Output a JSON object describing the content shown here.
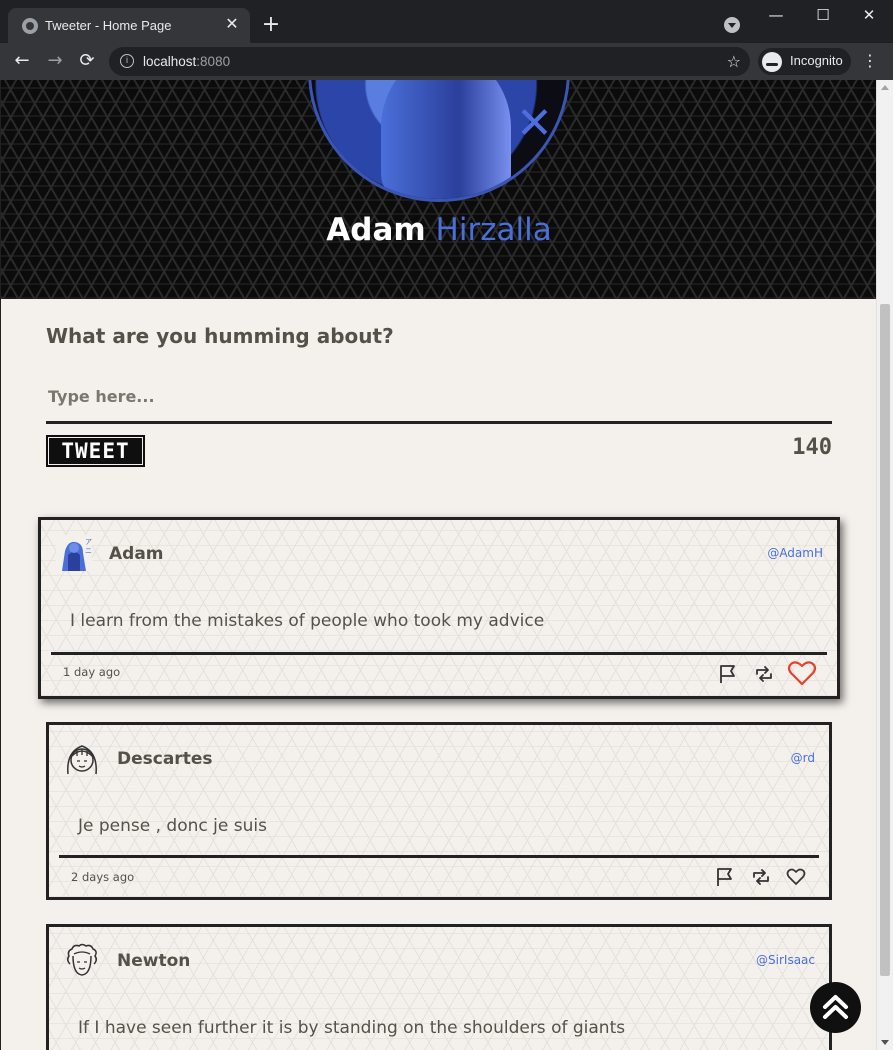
{
  "browser": {
    "tab_title": "Tweeter - Home Page",
    "url_host": "localhost",
    "url_port": ":8080",
    "incognito_label": "Incognito"
  },
  "hero": {
    "first_name": "Adam",
    "last_name": "Hirzalla"
  },
  "compose": {
    "question": "What are you humming about?",
    "placeholder": "Type here...",
    "button_label": "TWEET",
    "counter": "140"
  },
  "tweets": [
    {
      "name": "Adam",
      "handle": "@AdamH",
      "text": "I learn from the mistakes of people who took my advice",
      "date": "1 day ago",
      "liked": true,
      "avatar_icon": "anime-avatar-icon"
    },
    {
      "name": "Descartes",
      "handle": "@rd",
      "text": "Je pense , donc je suis",
      "date": "2 days ago",
      "liked": false,
      "avatar_icon": "girl-avatar-icon"
    },
    {
      "name": "Newton",
      "handle": "@SirIsaac",
      "text": "If I have seen further it is by standing on the shoulders of giants",
      "date": "",
      "liked": false,
      "avatar_icon": "curly-hair-avatar-icon"
    }
  ],
  "colors": {
    "accent_blue": "#4a6fd8",
    "like_red": "#e0432e",
    "text_gray": "#545149",
    "background": "#f4f1ec"
  }
}
